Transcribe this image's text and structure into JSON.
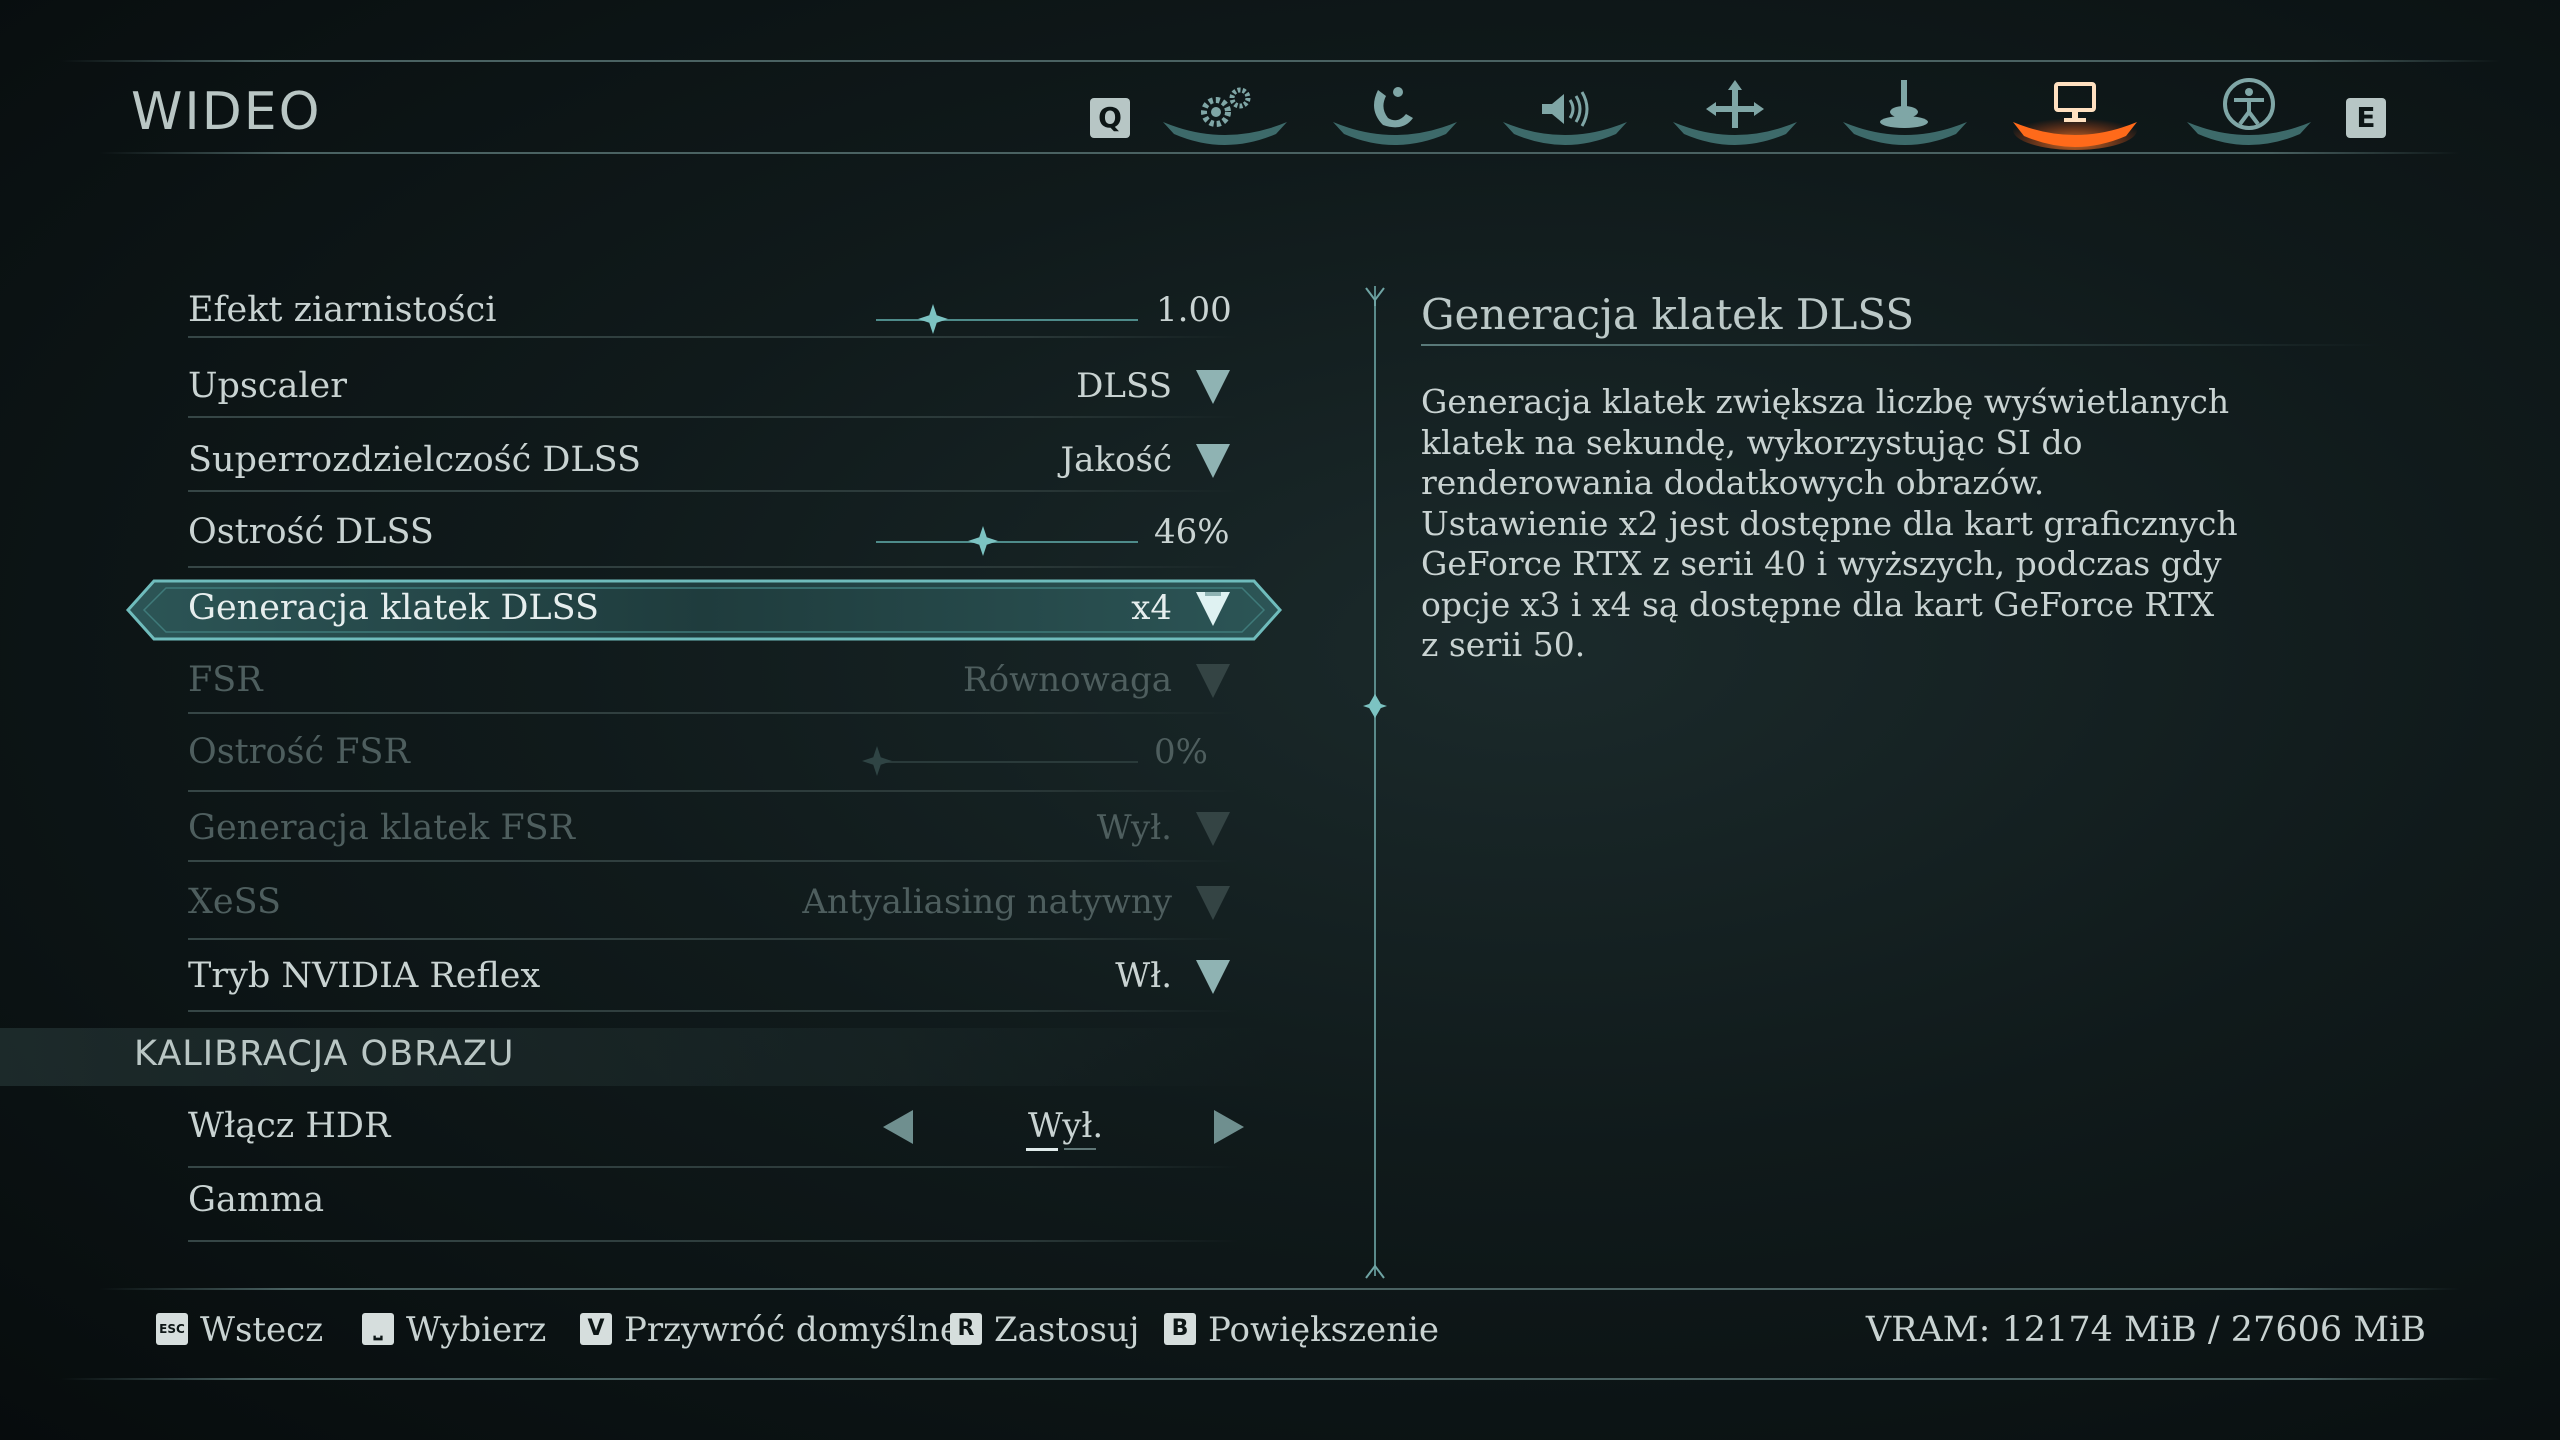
{
  "header": {
    "title": "WIDEO",
    "prev_key": "Q",
    "next_key": "E",
    "tabs": [
      {
        "icon": "gears-icon",
        "active": false
      },
      {
        "icon": "controller-icon",
        "active": false
      },
      {
        "icon": "speaker-icon",
        "active": false
      },
      {
        "icon": "dpad-icon",
        "active": false
      },
      {
        "icon": "joystick-icon",
        "active": false
      },
      {
        "icon": "monitor-icon",
        "active": true
      },
      {
        "icon": "accessibility-icon",
        "active": false
      }
    ]
  },
  "settings": [
    {
      "label": "Efekt ziarnistości",
      "type": "slider",
      "value": "1.00",
      "level": 0.25,
      "disabled": false
    },
    {
      "label": "Upscaler",
      "type": "dropdown",
      "value": "DLSS",
      "disabled": false
    },
    {
      "label": "Superrozdzielczość DLSS",
      "type": "dropdown",
      "value": "Jakość",
      "disabled": false
    },
    {
      "label": "Ostrość DLSS",
      "type": "slider",
      "value": "46%",
      "level": 0.46,
      "disabled": false
    },
    {
      "label": "Generacja klatek DLSS",
      "type": "dropdown",
      "value": "x4",
      "disabled": false,
      "selected": true
    },
    {
      "label": "FSR",
      "type": "dropdown",
      "value": "Równowaga",
      "disabled": true
    },
    {
      "label": "Ostrość FSR",
      "type": "slider",
      "value": "0%",
      "level": 0.0,
      "disabled": true
    },
    {
      "label": "Generacja klatek FSR",
      "type": "dropdown",
      "value": "Wył.",
      "disabled": true
    },
    {
      "label": "XeSS",
      "type": "dropdown",
      "value": "Antyaliasing natywny",
      "disabled": true
    },
    {
      "label": "Tryb NVIDIA Reflex",
      "type": "dropdown",
      "value": "Wł.",
      "disabled": false
    }
  ],
  "section": {
    "title": "KALIBRACJA OBRAZU",
    "items": [
      {
        "label": "Włącz HDR",
        "type": "selector",
        "value": "Wył.",
        "option_count": 2,
        "option_index": 0
      },
      {
        "label": "Gamma",
        "type": "none"
      }
    ]
  },
  "description": {
    "title": "Generacja klatek DLSS",
    "body": "Generacja klatek zwiększa liczbę wyświetlanych klatek na sekundę, wykorzystując SI do renderowania dodatkowych obrazów. Ustawienie x2 jest dostępne dla kart graficznych GeForce RTX z serii 40 i wyższych, podczas gdy opcje x3 i x4 są dostępne dla kart GeForce RTX z serii 50."
  },
  "footer": {
    "actions": [
      {
        "key": "ESC",
        "label": "Wstecz"
      },
      {
        "key": "⎵",
        "label": "Wybierz"
      },
      {
        "key": "V",
        "label": "Przywróć domyślne"
      },
      {
        "key": "R",
        "label": "Zastosuj"
      },
      {
        "key": "B",
        "label": "Powiększenie"
      }
    ],
    "vram": "VRAM: 12174 MiB / 27606 MiB"
  },
  "colors": {
    "accent": "#ff6a1a",
    "teal": "#6fbcbc",
    "text": "#c9d3d2",
    "disabled": "#4e5e5e"
  }
}
